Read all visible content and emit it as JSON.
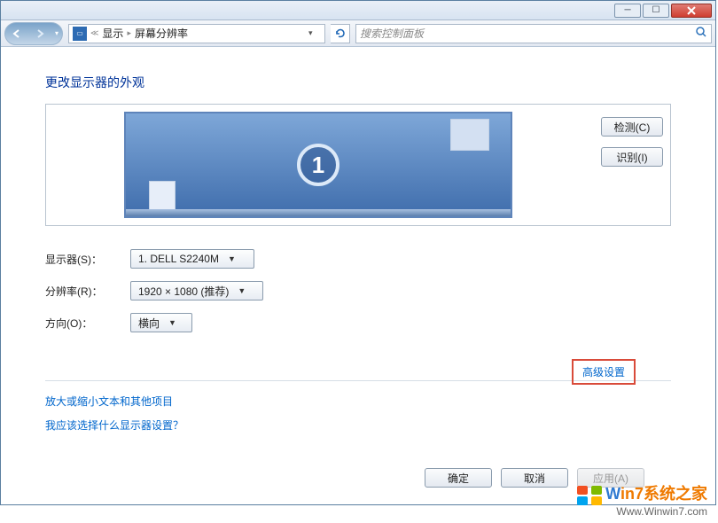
{
  "titlebar": {
    "minimize": "–",
    "maximize": "☐",
    "close": "×"
  },
  "nav": {
    "breadcrumb_item_1": "显示",
    "breadcrumb_item_2": "屏幕分辨率",
    "search_placeholder": "搜索控制面板"
  },
  "page": {
    "title": "更改显示器的外观",
    "monitor_number": "1"
  },
  "side_buttons": {
    "detect": "检测(C)",
    "identify": "识别(I)"
  },
  "form": {
    "monitor_label": "显示器(S)：",
    "monitor_value": "1. DELL S2240M",
    "resolution_label": "分辨率(R)：",
    "resolution_value": "1920 × 1080 (推荐)",
    "orientation_label": "方向(O)：",
    "orientation_value": "横向"
  },
  "links": {
    "advanced": "高级设置",
    "text_scaling": "放大或缩小文本和其他项目",
    "which_settings": "我应该选择什么显示器设置？"
  },
  "footer": {
    "ok": "确定",
    "cancel": "取消",
    "apply": "应用(A)"
  },
  "watermark": {
    "title_a": "W",
    "title_b": "in",
    "title_c": "7",
    "title_d": "系统之家",
    "sub": "Www.Winwin7.com"
  }
}
